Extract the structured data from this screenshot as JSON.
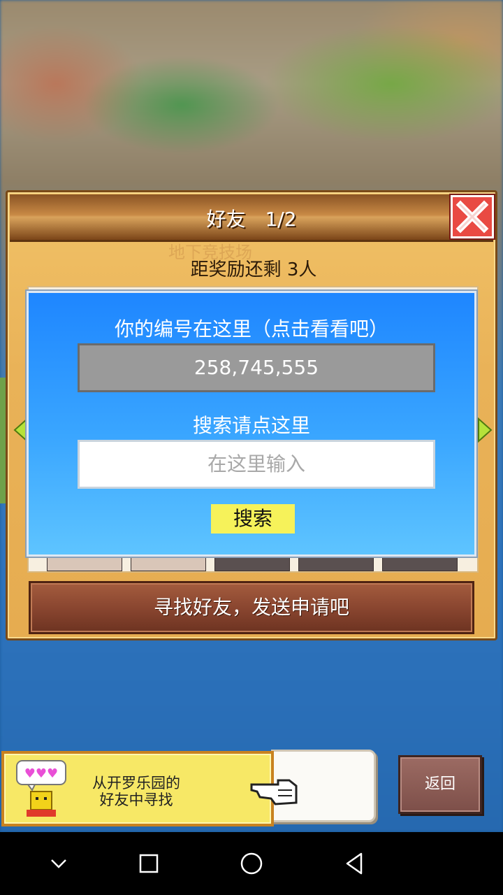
{
  "panel": {
    "title": "好友　1/2",
    "reward_remaining": "距奖励还剩 3人",
    "background_text": "地下竞技场"
  },
  "dialog": {
    "id_label": "你的编号在这里（点击看看吧）",
    "id_value": "258,745,555",
    "search_label": "搜索请点这里",
    "search_placeholder": "在这里输入",
    "search_button": "搜索"
  },
  "find_friends_button": "寻找好友，发送申请吧",
  "bottom": {
    "kairo_line1": "从开罗乐园的",
    "kairo_line2": "好友中寻找",
    "back_button": "返回"
  },
  "icons": [
    "close-icon",
    "arrow-left-icon",
    "arrow-right-icon",
    "hearts-speech-icon",
    "kairo-mascot-icon",
    "pointing-hand-icon",
    "nav-back-chevron-icon",
    "nav-recent-icon",
    "nav-home-icon",
    "nav-back-icon"
  ],
  "colors": {
    "panel_wood": "#e9b258",
    "dialog_blue": "#1e86ff",
    "search_button": "#f6f25a",
    "close_red": "#e94a43"
  }
}
